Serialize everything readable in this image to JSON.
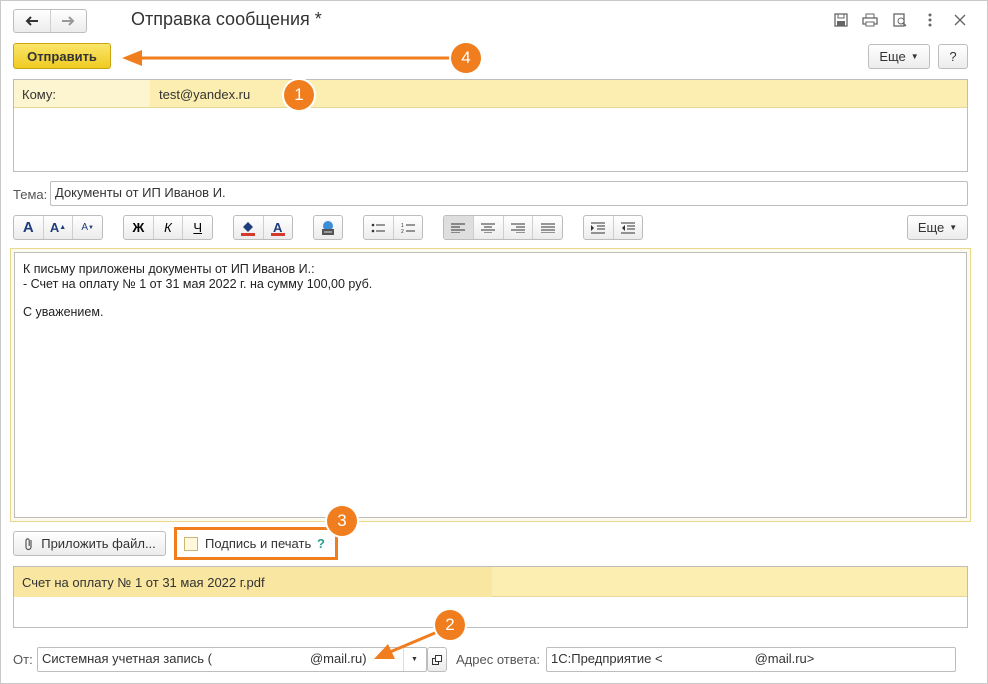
{
  "window": {
    "title": "Отправка сообщения *"
  },
  "toolbar": {
    "send_label": "Отправить",
    "more_label": "Еще",
    "help_label": "?"
  },
  "recipients": {
    "label": "Кому:",
    "value": "test@yandex.ru"
  },
  "subject": {
    "label": "Тема:",
    "value": "Документы от ИП Иванов И."
  },
  "format_toolbar": {
    "font_buttons": [
      "A",
      "A",
      "A"
    ],
    "style_buttons": [
      "Ж",
      "К",
      "Ч"
    ],
    "color_buttons": [
      "fill-color-icon",
      "font-color-icon"
    ],
    "more_label": "Еще"
  },
  "body": {
    "lines": [
      "К письму приложены документы от ИП Иванов И.:",
      "- Счет на оплату № 1 от 31 мая 2022 г. на сумму 100,00 руб.",
      "",
      "С уважением."
    ]
  },
  "attach": {
    "button_label": "Приложить файл...",
    "sign_label": "Подпись и печать",
    "help": "?",
    "sign_checked": false
  },
  "attachments": [
    {
      "name": "Счет на оплату № 1 от 31 мая 2022 г.pdf"
    }
  ],
  "from": {
    "label": "От:",
    "value_prefix": "Системная учетная запись (",
    "value_suffix": "@mail.ru)"
  },
  "reply": {
    "label": "Адрес ответа:",
    "value_prefix": "1С:Предприятие <",
    "value_suffix": "@mail.ru>"
  },
  "annotations": [
    "1",
    "2",
    "3",
    "4"
  ],
  "colors": {
    "accent": "#f07d1e",
    "send_button": "#f5d63a",
    "highlight": "#fbeeb0"
  }
}
